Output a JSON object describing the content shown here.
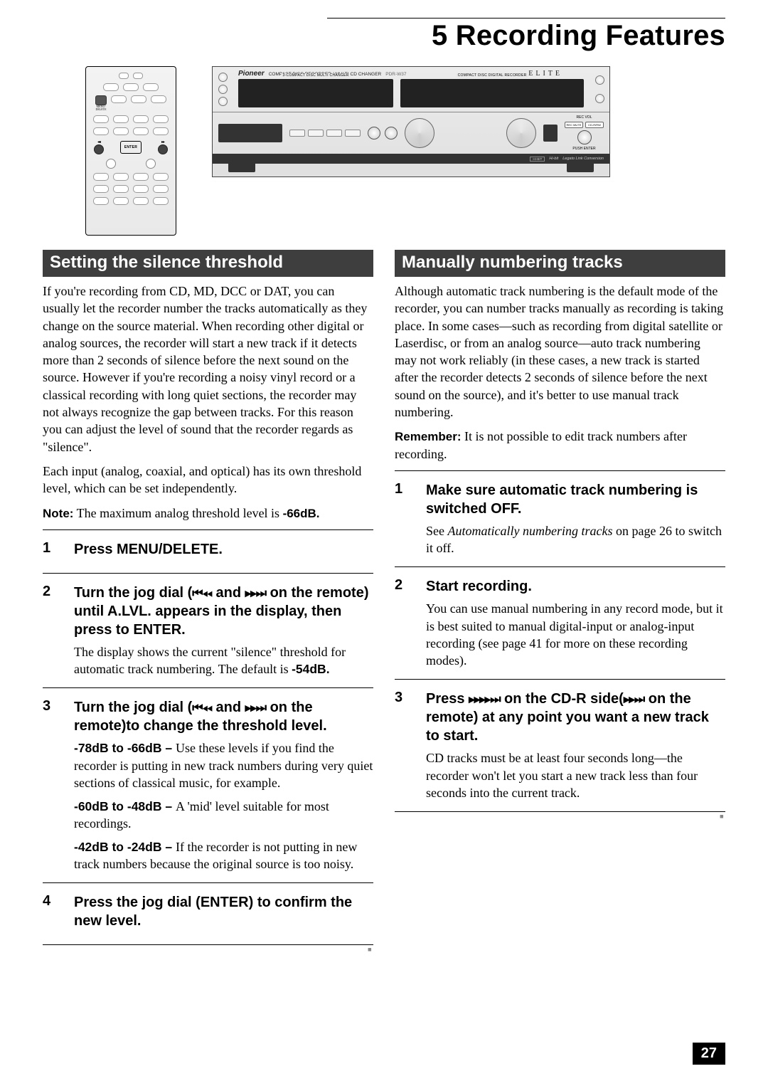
{
  "chapter": {
    "number": "5",
    "title": "Recording Features"
  },
  "page_number": "27",
  "remote": {
    "menu_delete_label": "MENU/\nDELETE",
    "enter_label": "ENTER",
    "prev_symbol": "◂◂",
    "next_symbol": "▸▸"
  },
  "device": {
    "brand": "Pioneer",
    "subtitle": "COMPACT DISC RECORDER / MULTI-CD CHANGER",
    "model": "PDR-W37",
    "elite": "ELITE",
    "left_display_label": "3-COMPACT DISC MULTI CHANGER",
    "right_display_label": "COMPACT DISC DIGITAL RECORDER",
    "rec_vol": "REC VOL",
    "push_enter": "PUSH ENTER",
    "btn_recmute": "REC MUTE",
    "btn_cdrmp": "CD-R/RW",
    "strip_badge": "Legato Link Conversion",
    "strip_badge_prefix": "Hi-bit"
  },
  "left_section": {
    "header": "Setting the silence threshold",
    "para1": "If you're recording from CD, MD, DCC or DAT, you can usually let the recorder number the tracks automatically as they change on the source material. When recording other digital or analog sources, the recorder will start a new track if it detects more than 2 seconds of silence before the next sound on the source. However if you're recording a noisy vinyl record or a classical recording with long quiet sections, the recorder may not always recognize the gap between tracks. For this reason you can adjust the level of sound that the recorder regards as \"silence\".",
    "para2": "Each input (analog, coaxial, and optical) has its own threshold level, which can be set independently.",
    "note_label": "Note:",
    "note_text": " The maximum analog threshold level is ",
    "note_value": "-66dB.",
    "steps": [
      {
        "n": "1",
        "title": "Press MENU/DELETE."
      },
      {
        "n": "2",
        "title_pre": "Turn the jog dial (",
        "title_sym1": "⏮◂◂",
        "title_mid": " and ",
        "title_sym2": "▸▸⏭",
        "title_post": " on the remote) until A.LVL. appears in the display, then press to ENTER.",
        "body": "The display shows the current \"silence\" threshold for automatic track numbering. The default is ",
        "body_value": "-54dB."
      },
      {
        "n": "3",
        "title_pre": "Turn the jog dial (",
        "title_sym1": "⏮◂◂",
        "title_mid": " and ",
        "title_sym2": "▸▸⏭",
        "title_post": " on the remote)to change the threshold level.",
        "r1_db": "-78dB to -66dB – ",
        "r1_text": "Use these levels if you find the recorder is putting in new track numbers during very quiet sections of classical music, for example.",
        "r2_db": "-60dB to -48dB – ",
        "r2_text": "A 'mid' level suitable for most recordings.",
        "r3_db": "-42dB to -24dB – ",
        "r3_text": "If the recorder is not putting in new track numbers because the original source is too noisy."
      },
      {
        "n": "4",
        "title": "Press the jog dial (ENTER) to confirm the new level."
      }
    ]
  },
  "right_section": {
    "header": "Manually numbering tracks",
    "para1": "Although automatic track numbering is the default mode of the recorder, you can number tracks manually as recording is taking place. In some cases—such as recording from digital satellite or Laserdisc, or from an analog source—auto track numbering may not work reliably (in these cases, a new track is started after the recorder detects 2 seconds of silence before the next sound on the source), and it's better to use manual track numbering.",
    "remember_label": "Remember:",
    "remember_text": " It is not possible to edit track numbers after recording.",
    "steps": [
      {
        "n": "1",
        "title": "Make sure automatic track numbering is switched OFF.",
        "body_pre": "See ",
        "body_em": "Automatically numbering tracks",
        "body_post": " on page 26 to switch it off."
      },
      {
        "n": "2",
        "title": "Start recording.",
        "body": "You can use manual numbering in any record mode, but it is best suited to manual digital-input or analog-input recording (see page 41 for more on these recording modes)."
      },
      {
        "n": "3",
        "title_pre": "Press ",
        "title_sym1": "▸▸▸▸⏭",
        "title_mid": " on the CD-R side(",
        "title_sym2": "▸▸⏭",
        "title_post": " on the remote) at any point you want a new track to start.",
        "body": "CD tracks must be at least four seconds long—the recorder won't let you start a new track less than four seconds into the current track."
      }
    ]
  }
}
